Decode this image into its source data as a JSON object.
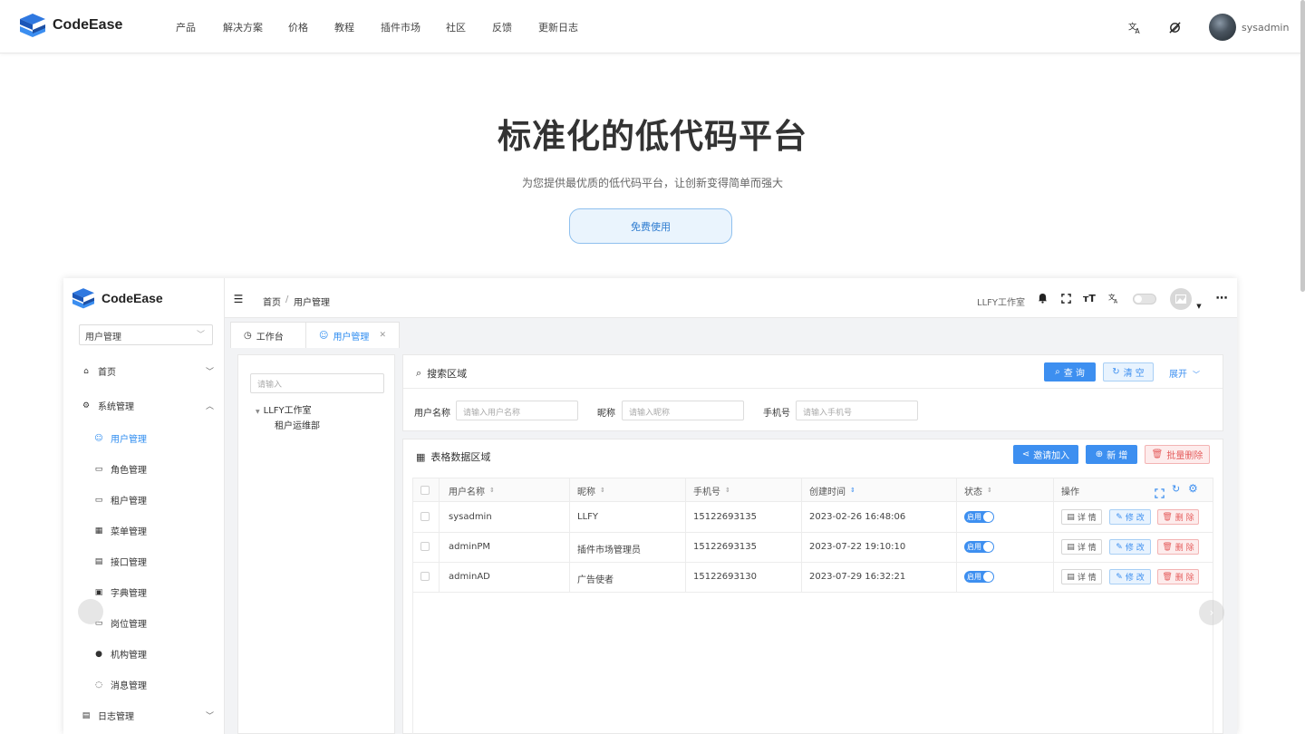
{
  "topnav": {
    "brand": "CodeEase",
    "items": [
      "产品",
      "解决方案",
      "价格",
      "教程",
      "插件市场",
      "社区",
      "反馈",
      "更新日志"
    ],
    "username": "sysadmin"
  },
  "hero": {
    "title": "标准化的低代码平台",
    "subtitle": "为您提供最优质的低代码平台，让创新变得简单而强大",
    "cta": "免费使用"
  },
  "app": {
    "brand": "CodeEase",
    "side_select": "用户管理",
    "menu": [
      {
        "label": "首页",
        "icon": "home-icon"
      },
      {
        "label": "系统管理",
        "icon": "gear-icon"
      },
      {
        "label": "用户管理",
        "icon": "user-icon"
      },
      {
        "label": "角色管理",
        "icon": "role-icon"
      },
      {
        "label": "租户管理",
        "icon": "tenant-icon"
      },
      {
        "label": "菜单管理",
        "icon": "grid-icon"
      },
      {
        "label": "接口管理",
        "icon": "api-icon"
      },
      {
        "label": "字典管理",
        "icon": "dict-icon"
      },
      {
        "label": "岗位管理",
        "icon": "post-icon"
      },
      {
        "label": "机构管理",
        "icon": "org-icon"
      },
      {
        "label": "消息管理",
        "icon": "message-icon"
      },
      {
        "label": "日志管理",
        "icon": "log-icon"
      }
    ],
    "breadcrumb": [
      "首页",
      "用户管理"
    ],
    "studio": "LLFY工作室",
    "tabs": [
      {
        "label": "工作台"
      },
      {
        "label": "用户管理"
      }
    ],
    "tree": {
      "placeholder": "请输入",
      "root": "LLFY工作室",
      "child": "租户运维部"
    },
    "search": {
      "title": "搜索区域",
      "query": "查 询",
      "clear": "清 空",
      "expand": "展开",
      "fields": [
        {
          "label": "用户名称",
          "placeholder": "请输入用户名称"
        },
        {
          "label": "昵称",
          "placeholder": "请输入昵称"
        },
        {
          "label": "手机号",
          "placeholder": "请输入手机号"
        }
      ]
    },
    "table": {
      "title": "表格数据区域",
      "invite": "邀请加入",
      "add": "新 增",
      "batch_delete": "批量删除",
      "headers": [
        "用户名称",
        "昵称",
        "手机号",
        "创建时间",
        "状态",
        "操作"
      ],
      "rows": [
        {
          "username": "sysadmin",
          "nickname": "LLFY",
          "phone": "15122693135",
          "created": "2023-02-26 16:48:06",
          "status": "启用"
        },
        {
          "username": "adminPM",
          "nickname": "插件市场管理员",
          "phone": "15122693135",
          "created": "2023-07-22 19:10:10",
          "status": "启用"
        },
        {
          "username": "adminAD",
          "nickname": "广告使者",
          "phone": "15122693130",
          "created": "2023-07-29 16:32:21",
          "status": "启用"
        }
      ],
      "ops": {
        "detail": "详 情",
        "edit": "修 改",
        "delete": "删 除"
      }
    }
  }
}
